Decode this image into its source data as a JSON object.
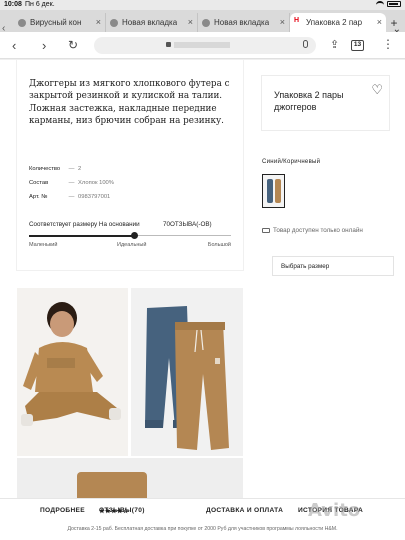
{
  "status": {
    "time": "10:08",
    "date": "Пн 6 дек."
  },
  "tabs": [
    {
      "label": "Вирусный кон"
    },
    {
      "label": "Новая вкладка"
    },
    {
      "label": "Новая вкладка"
    },
    {
      "label": "Упаковка 2 пар",
      "active": true
    }
  ],
  "toolbar": {
    "tab_count": "13"
  },
  "product": {
    "description": "Джоггеры из мягкого хлопкового футера с закрытой резинкой и кулиской на талии. Ложная застежка, накладные передние карманы, низ брючин собран на резинку.",
    "specs": [
      {
        "label": "Количество",
        "value": "2"
      },
      {
        "label": "Состав",
        "value": "Хлопок 100%"
      },
      {
        "label": "Арт. №",
        "value": "0983797001"
      }
    ],
    "fit": {
      "label": "Соответствует размеру На основании",
      "reviews": "70ОТЗЫВА(-ОВ)",
      "position": 0.52,
      "ticks": [
        "Маленький",
        "Идеальный",
        "Большой"
      ]
    },
    "title": "Упаковка 2 пары джоггеров",
    "color_label": "Синий/Коричневый",
    "availability": "Товар доступен только онлайн",
    "size_select": "Выбрать размер"
  },
  "bottom_nav": {
    "items": [
      "ПОДРОБНЕЕ",
      "ОТЗЫВЫ(70)",
      "ДОСТАВКА И ОПЛАТА",
      "ИСТОРИЯ ТОВАРА"
    ],
    "stars": "★★★★☆",
    "note": "Доставка 2-15 раб. Бесплатная доставка при покупке от 2000 Руб для участников программы лояльности H&M."
  },
  "watermark": "Avito",
  "colors": {
    "brand": "#e50010",
    "blue_pant": "#46627e",
    "brown_pant": "#b48753"
  }
}
